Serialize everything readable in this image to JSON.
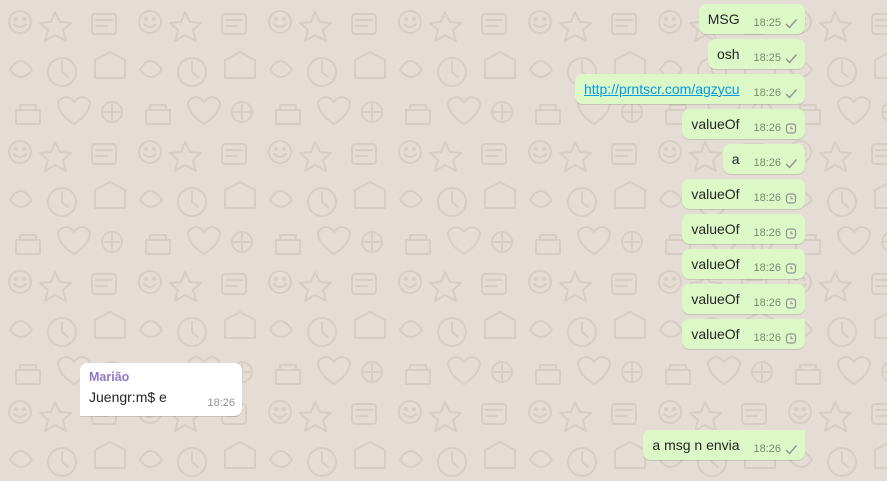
{
  "colors": {
    "wallpaper": "#e5ddd5",
    "outgoing_bubble": "#dcf8c6",
    "incoming_bubble": "#ffffff",
    "sender_name": "#8f79c9",
    "link": "#039be5"
  },
  "messages": [
    {
      "direction": "out",
      "text": "MSG",
      "time": "18:25",
      "status": "sent-check-icon"
    },
    {
      "direction": "out",
      "text": "osh",
      "time": "18:25",
      "status": "sent-check-icon"
    },
    {
      "direction": "out",
      "text": "http://prntscr.com/agzycu",
      "is_link": true,
      "time": "18:26",
      "status": "sent-check-icon"
    },
    {
      "direction": "out",
      "text": "valueOf",
      "time": "18:26",
      "status": "pending-clock-icon"
    },
    {
      "direction": "out",
      "text": "a",
      "time": "18:26",
      "status": "sent-check-icon"
    },
    {
      "direction": "out",
      "text": "valueOf",
      "time": "18:26",
      "status": "pending-clock-icon"
    },
    {
      "direction": "out",
      "text": "valueOf",
      "time": "18:26",
      "status": "pending-clock-icon"
    },
    {
      "direction": "out",
      "text": "valueOf",
      "time": "18:26",
      "status": "pending-clock-icon"
    },
    {
      "direction": "out",
      "text": "valueOf",
      "time": "18:26",
      "status": "pending-clock-icon"
    },
    {
      "direction": "out",
      "text": "valueOf",
      "time": "18:26",
      "status": "pending-clock-icon"
    },
    {
      "direction": "in",
      "sender": "Marião",
      "text": "Juengr:m$ e",
      "time": "18:26"
    },
    {
      "direction": "out",
      "text": "a msg n envia",
      "time": "18:26",
      "status": "sent-check-icon"
    }
  ]
}
